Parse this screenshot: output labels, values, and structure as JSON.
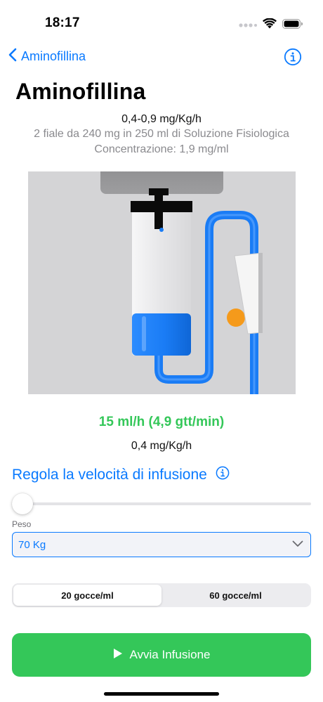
{
  "status_bar": {
    "time": "18:17",
    "icons": [
      "signal-dots-icon",
      "wifi-icon",
      "battery-icon"
    ]
  },
  "nav": {
    "back_label": "Aminofillina",
    "back_icon": "chevron-left-icon",
    "info_icon": "info-icon"
  },
  "header": {
    "title": "Aminofillina",
    "dose_range": "0,4-0,9 mg/Kg/h",
    "preparation": "2 fiale da 240 mg in 250 ml di Soluzione Fisiologica",
    "concentration": "Concentrazione: 1,9 mg/ml"
  },
  "illustration": {
    "icon": "iv-drip-illustration",
    "fluid_level": 0.3,
    "colors": {
      "background": "#d4d4d6",
      "fluid": "#1a7cf5",
      "tube": "#1a7cf5",
      "clamp_wheel": "#f59a1b",
      "hanger": "#909090"
    }
  },
  "result": {
    "rate": "15 ml/h (4,9 gtt/min)",
    "dose": "0,4 mg/Kg/h"
  },
  "rate_section": {
    "title": "Regola la velocità di infusione",
    "info_icon": "info-icon",
    "slider_value": 0
  },
  "weight": {
    "label": "Peso",
    "value": "70 Kg",
    "chevron_icon": "chevron-down-icon"
  },
  "drop_factor": {
    "options": [
      "20 gocce/ml",
      "60 gocce/ml"
    ],
    "selected": "20 gocce/ml"
  },
  "start_button": {
    "label": "Avvia Infusione",
    "icon": "play-icon"
  },
  "colors": {
    "accent": "#0a7aff",
    "success": "#34c759"
  }
}
